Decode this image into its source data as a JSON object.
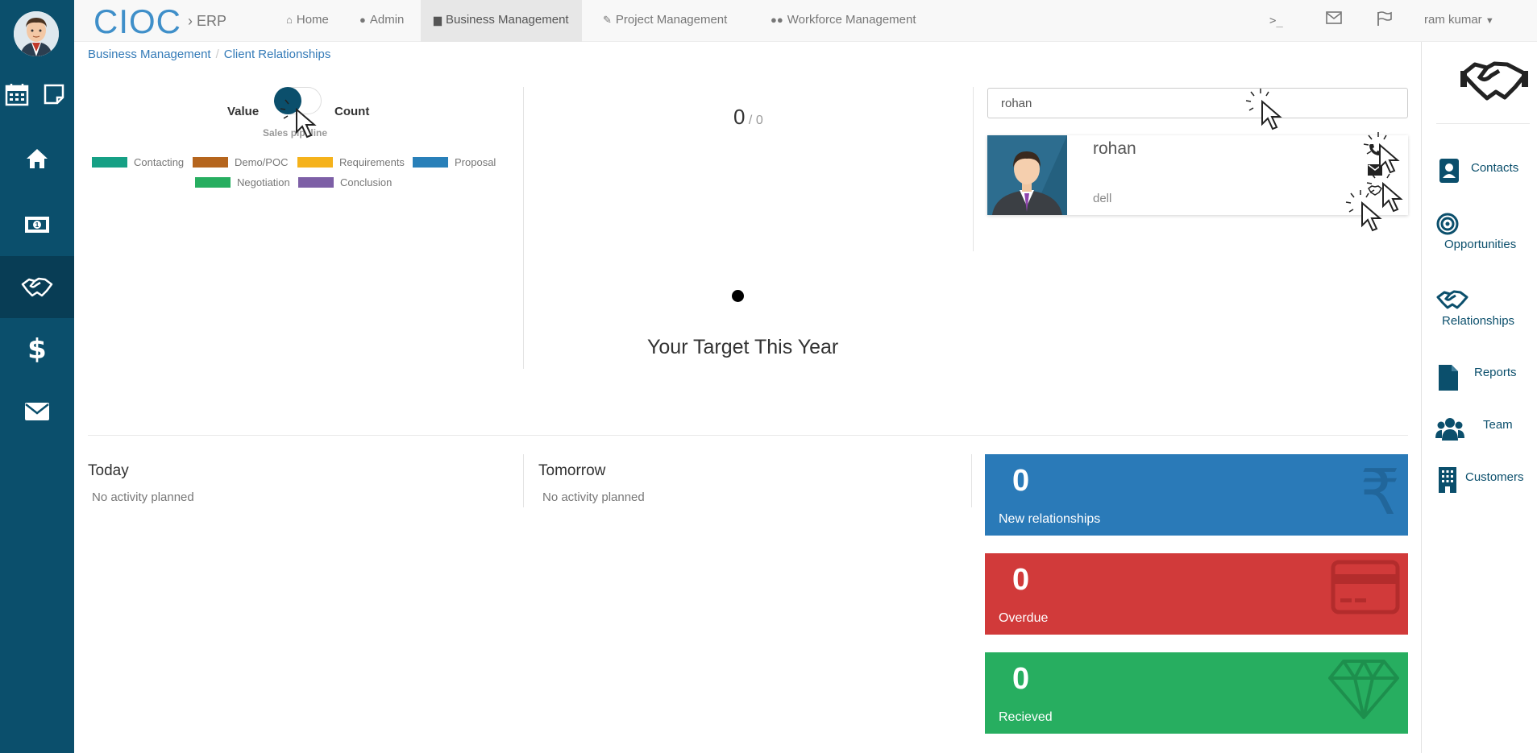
{
  "brand": {
    "name": "CIOC",
    "sub": "› ERP"
  },
  "nav": {
    "items": [
      {
        "label": "Home",
        "icon": "home-icon"
      },
      {
        "label": "Admin",
        "icon": "user-icon"
      },
      {
        "label": "Business Management",
        "icon": "chart-icon"
      },
      {
        "label": "Project Management",
        "icon": "wrench-icon"
      },
      {
        "label": "Workforce Management",
        "icon": "users-icon"
      }
    ],
    "user": "ram kumar"
  },
  "breadcrumb": {
    "parent": "Business Management",
    "current": "Client Relationships"
  },
  "pipeline": {
    "toggle_left": "Value",
    "toggle_right": "Count",
    "caption": "Sales pipeline",
    "legend": [
      {
        "label": "Contacting",
        "color": "#16a085"
      },
      {
        "label": "Demo/POC",
        "color": "#b5651d"
      },
      {
        "label": "Requirements",
        "color": "#f5b21b"
      },
      {
        "label": "Proposal",
        "color": "#2980b9"
      },
      {
        "label": "Negotiation",
        "color": "#27ae60"
      },
      {
        "label": "Conclusion",
        "color": "#7d5fa6"
      }
    ]
  },
  "target": {
    "achieved": "0",
    "total": "0",
    "title": "Your Target This Year"
  },
  "search": {
    "value": "rohan"
  },
  "contact": {
    "name": "rohan",
    "company": "dell"
  },
  "activities": {
    "today": {
      "title": "Today",
      "text": "No activity planned"
    },
    "tomorrow": {
      "title": "Tomorrow",
      "text": "No activity planned"
    }
  },
  "stats": [
    {
      "value": "0",
      "label": "New relationships",
      "color": "#2a7ab8"
    },
    {
      "value": "0",
      "label": "Overdue",
      "color": "#d13a3a"
    },
    {
      "value": "0",
      "label": "Recieved",
      "color": "#27ae60"
    }
  ],
  "right_sidebar": [
    {
      "label": "Contacts",
      "icon": "contact-card-icon"
    },
    {
      "label": "Opportunities",
      "icon": "target-icon"
    },
    {
      "label": "Relationships",
      "icon": "handshake-icon"
    },
    {
      "label": "Reports",
      "icon": "document-icon"
    },
    {
      "label": "Team",
      "icon": "team-icon"
    },
    {
      "label": "Customers",
      "icon": "building-icon"
    }
  ],
  "colors": {
    "sidebar": "#0b4f6c",
    "brand": "#3f8fc9",
    "link": "#337ab7"
  }
}
